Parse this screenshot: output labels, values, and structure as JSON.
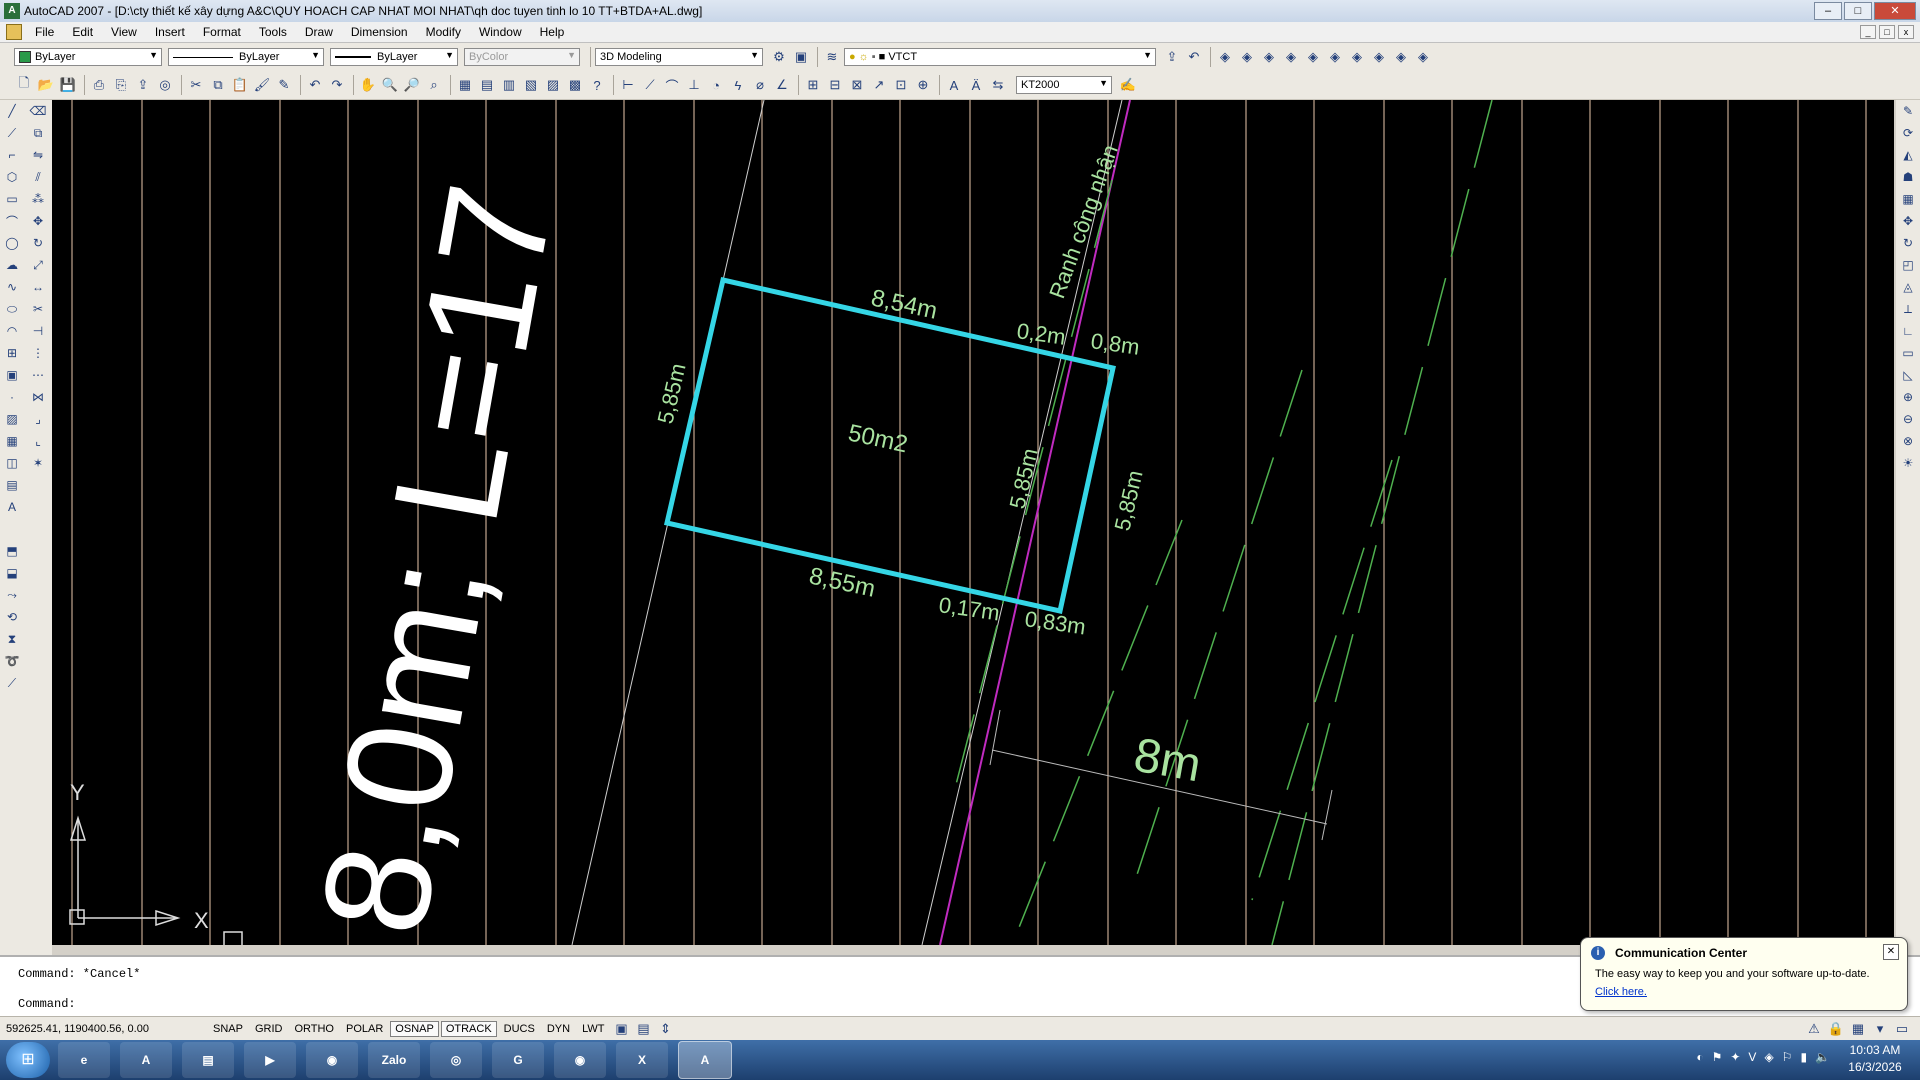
{
  "window": {
    "title": "AutoCAD 2007 - [D:\\cty thiết kế xây dựng A&C\\QUY HOACH CAP NHAT MOI NHAT\\qh doc tuyen tinh lo 10 TT+BTDA+AL.dwg]",
    "app_icon": "autocad-icon"
  },
  "menu": [
    "File",
    "Edit",
    "View",
    "Insert",
    "Format",
    "Tools",
    "Draw",
    "Dimension",
    "Modify",
    "Window",
    "Help"
  ],
  "toolbar1": {
    "layer_color": "ByLayer",
    "linetype": "ByLayer",
    "lineweight": "ByLayer",
    "plotstyle": "ByColor",
    "workspace": "3D Modeling",
    "current_layer": "VTCT"
  },
  "toolbar2": {
    "dimstyle": "KT2000"
  },
  "drawing": {
    "labels": {
      "top_edge": "8,54m",
      "top_right_a": "0,2m",
      "top_right_b": "0,8m",
      "left_edge": "5,85m",
      "area": "50m2",
      "inner_right": "5,85m",
      "right_edge": "5,85m",
      "bottom_edge": "8,55m",
      "bottom_right_a": "0,17m",
      "bottom_right_b": "0,83m",
      "boundary": "Ranh công nhận",
      "road_width": "8m",
      "big_label": "8,0m; L=17",
      "ucs_x": "X",
      "ucs_y": "Y"
    },
    "colors": {
      "background": "#000000",
      "rectangle": "#35d6e6",
      "text": "#a9e3a0",
      "boundary_line": "#c02bc0",
      "grid_lines": "#d9b9a0",
      "green_dash": "#4fb04f"
    }
  },
  "command": {
    "line1": "Command: *Cancel*",
    "line2": "Command:"
  },
  "status": {
    "coordinates": "592625.41, 1190400.56, 0.00",
    "toggles": [
      {
        "label": "SNAP",
        "on": false
      },
      {
        "label": "GRID",
        "on": false
      },
      {
        "label": "ORTHO",
        "on": false
      },
      {
        "label": "POLAR",
        "on": false
      },
      {
        "label": "OSNAP",
        "on": true
      },
      {
        "label": "OTRACK",
        "on": true
      },
      {
        "label": "DUCS",
        "on": false
      },
      {
        "label": "DYN",
        "on": false
      },
      {
        "label": "LWT",
        "on": false
      }
    ]
  },
  "balloon": {
    "title": "Communication Center",
    "text": "The easy way to keep you and your software up-to-date.",
    "link": "Click here."
  },
  "taskbar": {
    "apps": [
      "ie-icon",
      "autocad-icon",
      "explorer-icon",
      "media-player-icon",
      "chrome-icon",
      "zalo-icon",
      "app-icon",
      "app-icon",
      "chrome-icon",
      "excel-icon",
      "autocad-icon"
    ],
    "zalo_label": "Zalo",
    "time": "10:03 AM",
    "date": "16/3/2026"
  }
}
